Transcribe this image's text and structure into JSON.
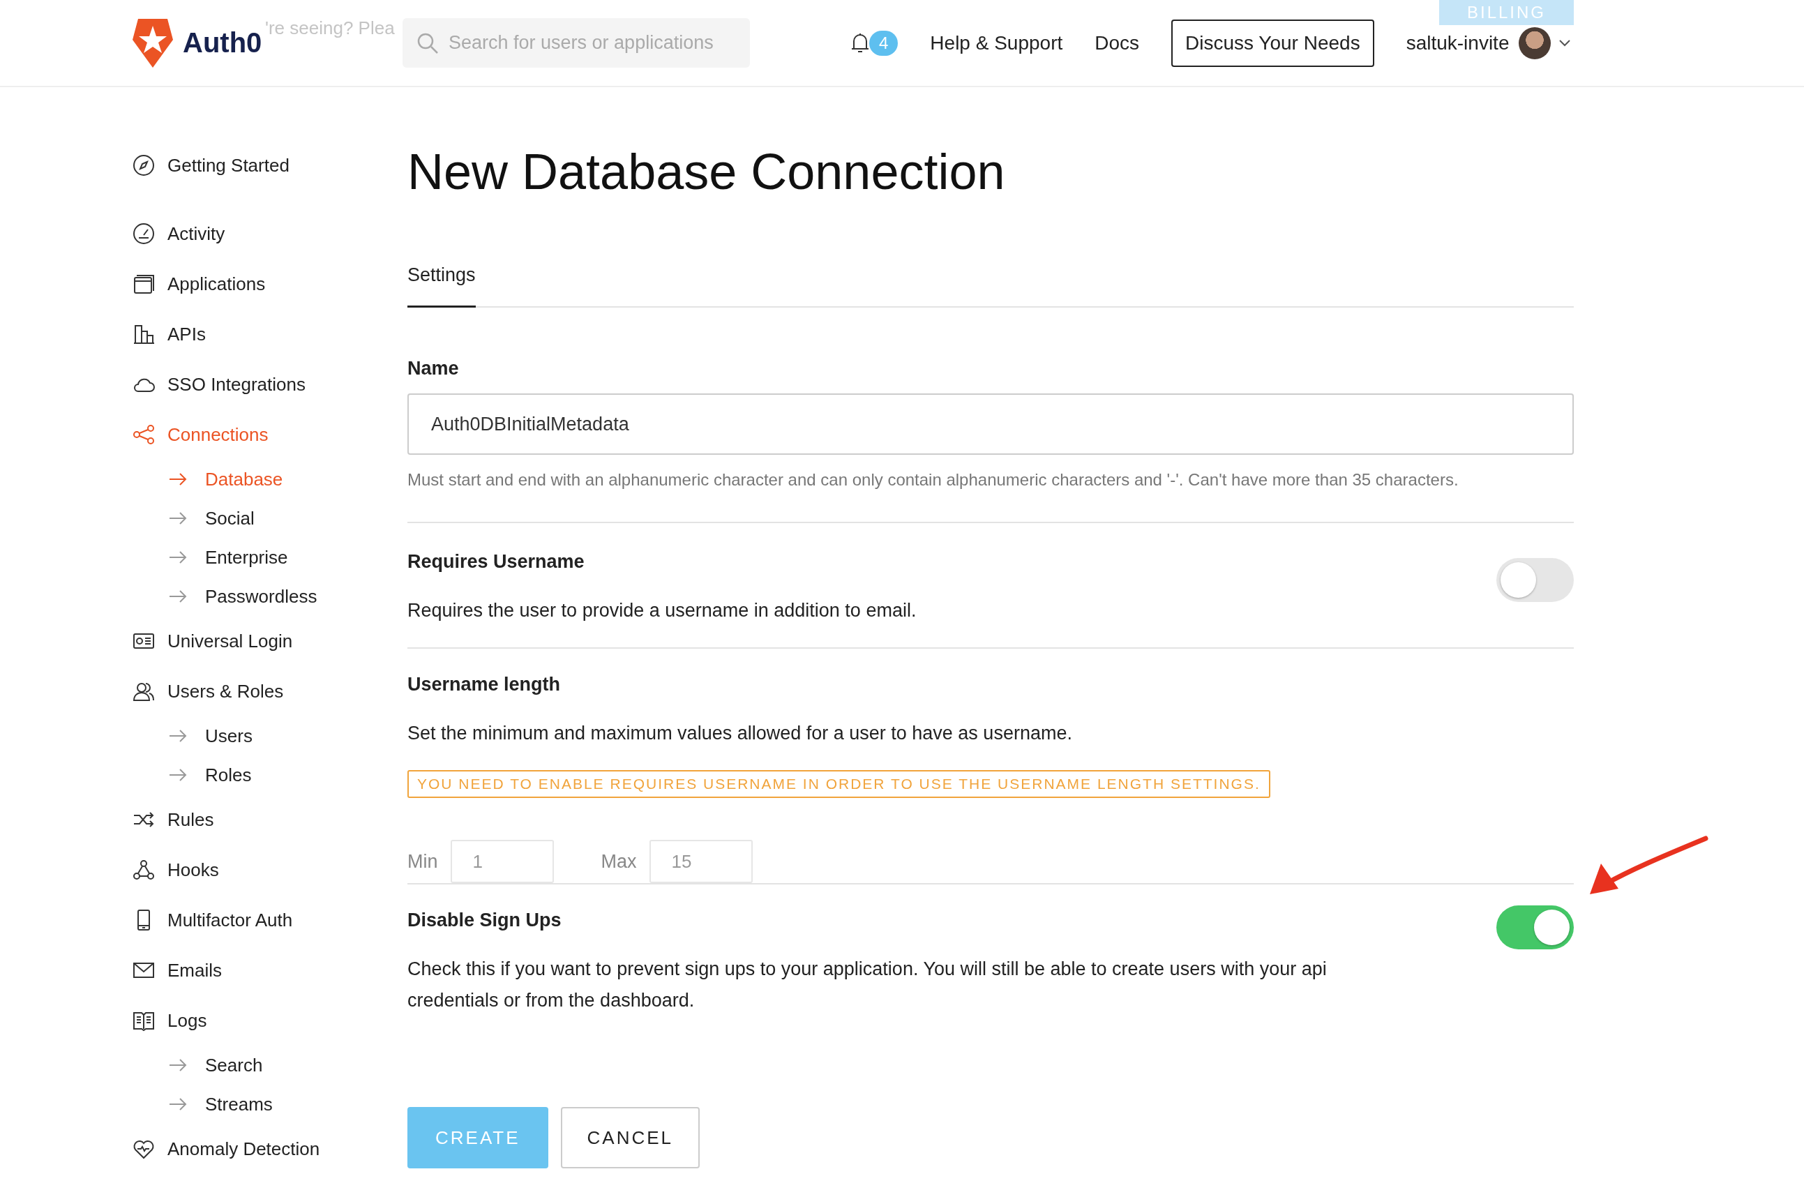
{
  "banner": {
    "text": "'re seeing? Plea",
    "button": "BILLING"
  },
  "header": {
    "logo_text": "Auth0",
    "search": {
      "placeholder": "Search for users or applications"
    },
    "notifications": "4",
    "links": [
      "Help & Support",
      "Docs"
    ],
    "cta": "Discuss Your Needs",
    "user": "saltuk-invite"
  },
  "sidebar": {
    "items": [
      {
        "label": "Getting Started",
        "selected": false
      },
      {
        "label": "Activity",
        "selected": false
      },
      {
        "label": "Applications",
        "selected": false
      },
      {
        "label": "APIs",
        "selected": false
      },
      {
        "label": "SSO Integrations",
        "selected": false
      },
      {
        "label": "Connections",
        "selected": true,
        "children": [
          {
            "label": "Database",
            "selected": true
          },
          {
            "label": "Social",
            "selected": false
          },
          {
            "label": "Enterprise",
            "selected": false
          },
          {
            "label": "Passwordless",
            "selected": false
          }
        ]
      },
      {
        "label": "Universal Login",
        "selected": false
      },
      {
        "label": "Users & Roles",
        "selected": false,
        "children": [
          {
            "label": "Users",
            "selected": false
          },
          {
            "label": "Roles",
            "selected": false
          }
        ]
      },
      {
        "label": "Rules",
        "selected": false
      },
      {
        "label": "Hooks",
        "selected": false
      },
      {
        "label": "Multifactor Auth",
        "selected": false
      },
      {
        "label": "Emails",
        "selected": false
      },
      {
        "label": "Logs",
        "selected": false,
        "children": [
          {
            "label": "Search",
            "selected": false
          },
          {
            "label": "Streams",
            "selected": false
          }
        ]
      },
      {
        "label": "Anomaly Detection",
        "selected": false
      }
    ]
  },
  "title": "New Database Connection",
  "tabs": [
    {
      "label": "Settings",
      "selected": true
    }
  ],
  "name_field": {
    "label": "Name",
    "value": "Auth0DBInitialMetadata",
    "hint": "Must start and end with an alphanumeric character and can only contain alphanumeric characters and '-'. Can't have more than 35 characters."
  },
  "requires_username": {
    "label": "Requires Username",
    "description": "Requires the user to provide a username in addition to email.",
    "on": false
  },
  "username_length": {
    "label": "Username length",
    "description": "Set the minimum and maximum values allowed for a user to have as username.",
    "warning": "YOU NEED TO ENABLE REQUIRES USERNAME IN ORDER TO USE THE USERNAME LENGTH SETTINGS.",
    "fields": [
      {
        "label": "Min",
        "value": "1",
        "disabled": true
      },
      {
        "label": "Max",
        "value": "15",
        "disabled": true
      }
    ]
  },
  "disable_sign_ups": {
    "label": "Disable Sign Ups",
    "description": "Check this if you want to prevent sign ups to your application. You will still be able to create users with your api credentials or from the dashboard.",
    "on": true
  },
  "buttons": [
    {
      "label": "CREATE",
      "kind": "primary"
    },
    {
      "label": "CANCEL",
      "kind": "secondary"
    }
  ]
}
